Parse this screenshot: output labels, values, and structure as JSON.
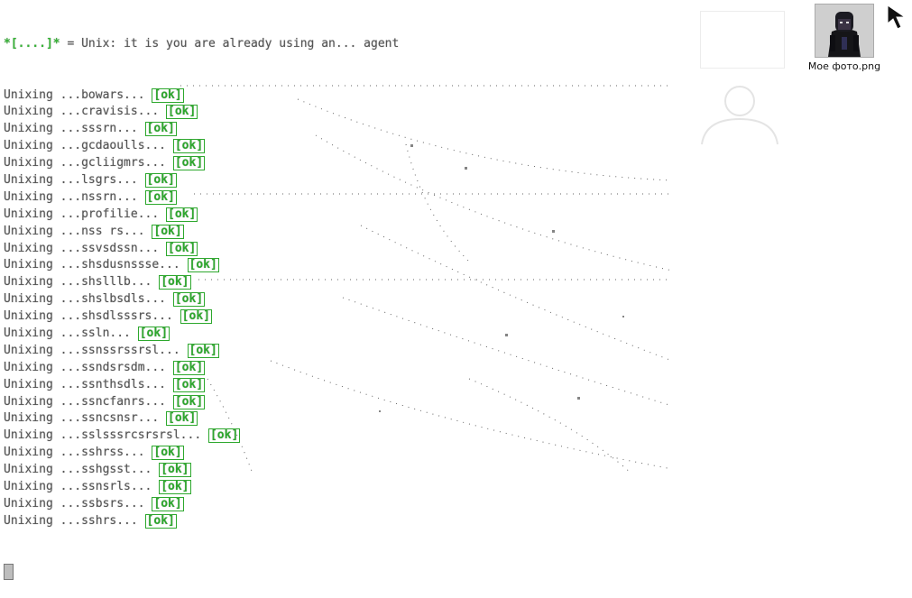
{
  "terminal": {
    "header": {
      "prefix": "*[....]*",
      "text": " = Unix: it is you are already using an... agent"
    },
    "status": "ok",
    "lines": [
      "Unixing ...bowars...",
      "Unixing ...cravisis...",
      "Unixing ...sssrn...",
      "Unixing ...gcdaoulls...",
      "Unixing ...gcliigmrs...",
      "Unixing ...lsgrs...",
      "Unixing ...nssrn...",
      "Unixing ...profilie...",
      "Unixing ...nss rs...",
      "Unixing ...ssvsdssn...",
      "Unixing ...shsdusnssse...",
      "Unixing ...shslllb...",
      "Unixing ...shslbsdls...",
      "Unixing ...shsdlsssrs...",
      "Unixing ...ssln...",
      "Unixing ...ssnssrssrsl...",
      "Unixing ...ssndsrsdm...",
      "Unixing ...ssnthsdls...",
      "Unixing ...ssncfanrs...",
      "Unixing ...ssncsnsr...",
      "Unixing ...sslsssrcsrsrsl...",
      "Unixing ...sshrss...",
      "Unixing ...sshgsst...",
      "Unixing ...ssnsrls...",
      "Unixing ...ssbsrs...",
      "Unixing ...sshrs..."
    ]
  },
  "desktop": {
    "file_label": "Мое фото.png"
  },
  "colors": {
    "ok_green": "#2da82d",
    "text_gray": "#555555"
  }
}
